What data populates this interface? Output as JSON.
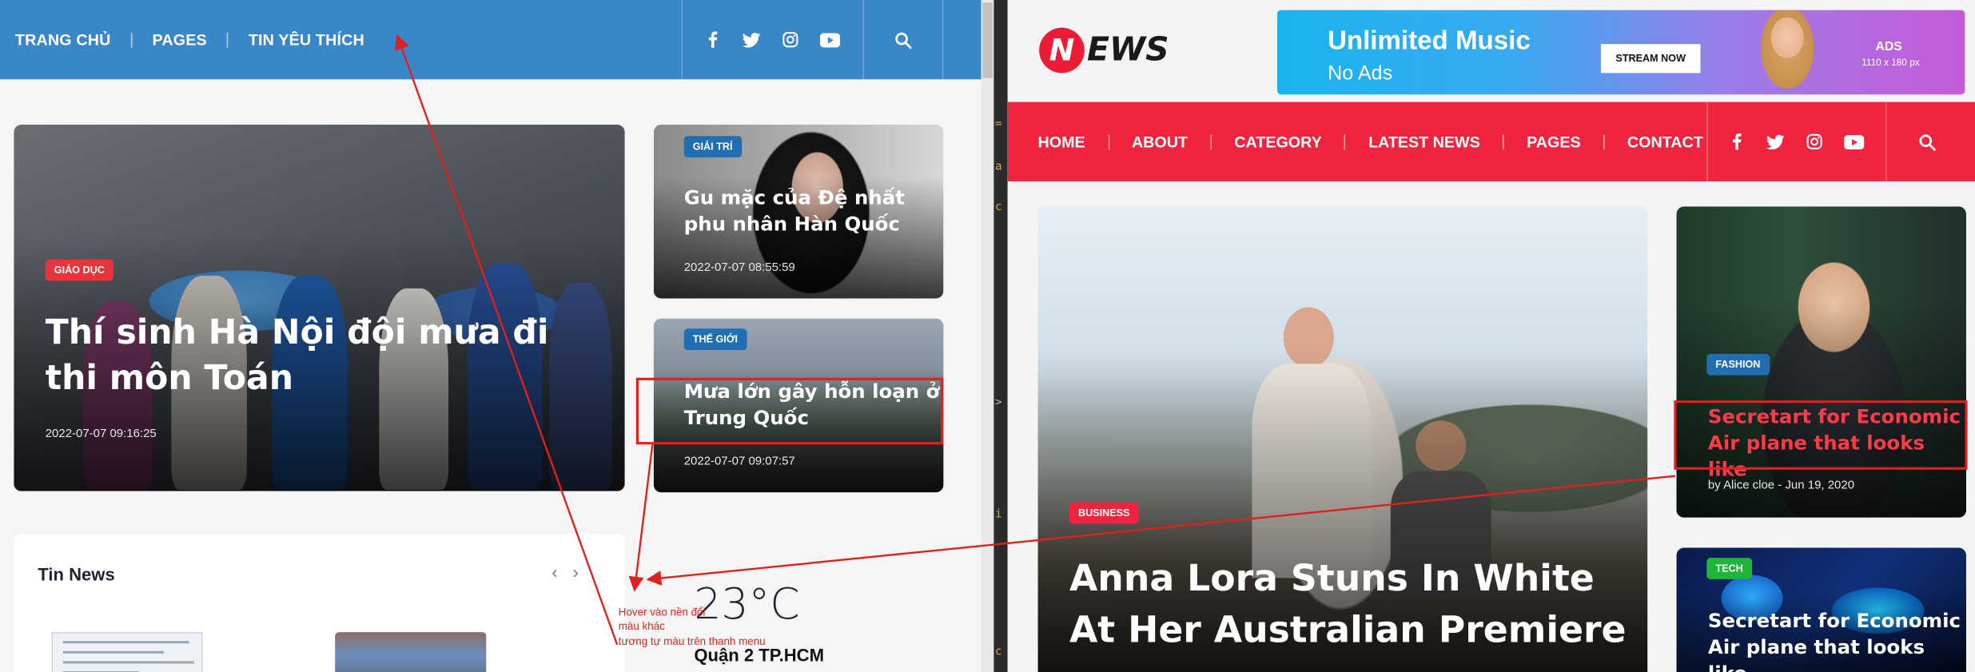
{
  "left": {
    "nav": {
      "items": [
        "TRANG CHỦ",
        "PAGES",
        "TIN YÊU THÍCH"
      ],
      "social_icons": [
        "facebook-icon",
        "twitter-icon",
        "instagram-icon",
        "youtube-icon"
      ],
      "search_icon": "search-icon",
      "bg_color": "#3a87c8"
    },
    "featured": {
      "badge": "GIÁO DỤC",
      "badge_color": "#e8353b",
      "title": "Thí sinh Hà Nội đội mưa đi thi môn Toán",
      "date": "2022-07-07 09:16:25"
    },
    "side_posts": [
      {
        "badge": "GIẢI TRÍ",
        "badge_color": "#1f6fb2",
        "title": "Gu mặc của Đệ nhất phu nhân Hàn Quốc",
        "date": "2022-07-07 08:55:59"
      },
      {
        "badge": "THẾ GIỚI",
        "badge_color": "#1f6fb2",
        "title": "Mưa lớn gây hỗn loạn ở Trung Quốc",
        "date": "2022-07-07 09:07:57"
      }
    ],
    "tin_news": {
      "title": "Tin News",
      "prev_icon": "chevron-left-icon",
      "next_icon": "chevron-right-icon"
    },
    "weather": {
      "temperature": "23°C",
      "location": "Quận 2 TP.HCM"
    },
    "annotation": {
      "lines": [
        "Hover vào nền đổi",
        "màu khác",
        "tương tự màu trên thanh menu"
      ],
      "color": "#d9261c"
    }
  },
  "right": {
    "logo": {
      "letter": "N",
      "rest": "EWS"
    },
    "ad": {
      "title": "Unlimited Music",
      "subtitle": "No Ads",
      "button": "STREAM NOW",
      "label": "ADS",
      "size": "1110 x 180 px"
    },
    "nav": {
      "items": [
        "HOME",
        "ABOUT",
        "CATEGORY",
        "LATEST NEWS",
        "PAGES",
        "CONTACT"
      ],
      "social_icons": [
        "facebook-icon",
        "twitter-icon",
        "instagram-icon",
        "youtube-icon"
      ],
      "search_icon": "search-icon",
      "bg_color": "#f0243f"
    },
    "featured": {
      "badge": "BUSINESS",
      "badge_color": "#f0243f",
      "title": "Anna Lora Stuns In White At Her Australian Premiere"
    },
    "side_posts": [
      {
        "badge": "FASHION",
        "badge_color": "#1f6fb2",
        "title": "Secretart for Economic Air plane that looks like",
        "meta": "by Alice cloe - Jun 19, 2020",
        "title_color": "#ff3b4a"
      },
      {
        "badge": "TECH",
        "badge_color": "#1fb539",
        "title": "Secretart for Economic Air plane that looks like"
      }
    ]
  }
}
